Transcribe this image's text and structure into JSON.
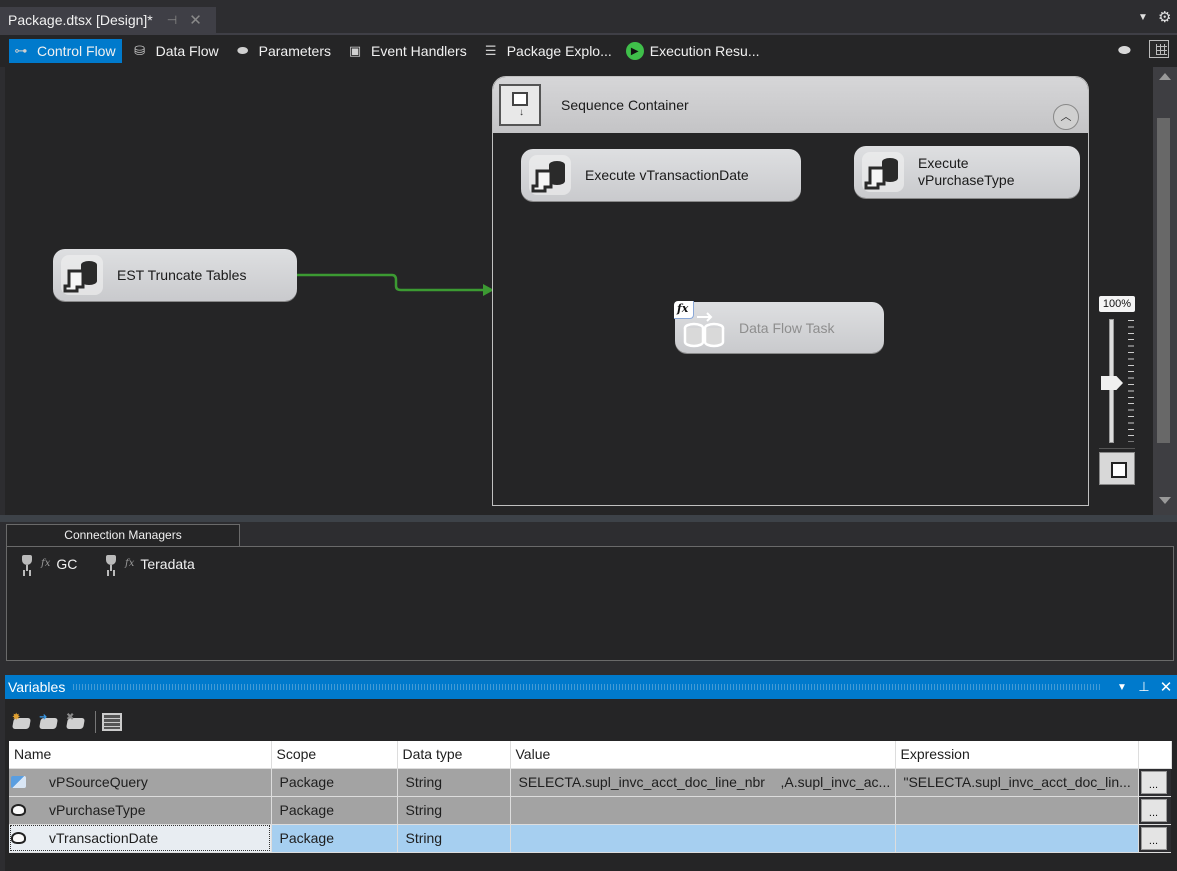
{
  "document_tab": {
    "title": "Package.dtsx [Design]*",
    "pin_icon": "pin-icon",
    "close_icon": "close-icon"
  },
  "designer_tabs": [
    {
      "label": "Control Flow",
      "icon": "control-flow-icon",
      "active": true
    },
    {
      "label": "Data Flow",
      "icon": "data-flow-icon",
      "active": false
    },
    {
      "label": "Parameters",
      "icon": "parameters-icon",
      "active": false
    },
    {
      "label": "Event Handlers",
      "icon": "event-handlers-icon",
      "active": false
    },
    {
      "label": "Package Explo...",
      "icon": "package-explorer-icon",
      "active": false
    },
    {
      "label": "Execution Resu...",
      "icon": "execution-results-icon",
      "active": false
    }
  ],
  "canvas": {
    "tasks": {
      "truncate": {
        "label": "EST Truncate Tables"
      },
      "exec_date": {
        "label": "Execute vTransactionDate"
      },
      "exec_purchase": {
        "label_line1": "Execute",
        "label_line2": "vPurchaseType"
      },
      "data_flow": {
        "label": "Data Flow Task",
        "disabled": true,
        "badge": "fx"
      }
    },
    "container": {
      "label": "Sequence Container"
    },
    "precedence_color": "#3c9a32",
    "zoom": {
      "label": "100%",
      "value_percent": 100
    }
  },
  "connection_managers": {
    "tab_label": "Connection Managers",
    "items": [
      {
        "name": "GC",
        "badge": "fx"
      },
      {
        "name": "Teradata",
        "badge": "fx"
      }
    ]
  },
  "variables": {
    "title": "Variables",
    "columns": [
      "Name",
      "Scope",
      "Data type",
      "Value",
      "Expression"
    ],
    "rows": [
      {
        "icon": "expression-variable-icon",
        "name": "vPSourceQuery",
        "scope": "Package",
        "data_type": "String",
        "value": "SELECTA.supl_invc_acct_doc_line_nbr    ,A.supl_invc_ac...",
        "expression": "\"SELECTA.supl_invc_acct_doc_lin...",
        "button": "..."
      },
      {
        "icon": "variable-icon",
        "name": "vPurchaseType",
        "scope": "Package",
        "data_type": "String",
        "value": "",
        "expression": "",
        "button": "..."
      },
      {
        "icon": "variable-icon",
        "name": "vTransactionDate",
        "scope": "Package",
        "data_type": "String",
        "value": "",
        "expression": "",
        "button": "...",
        "selected": true
      }
    ]
  }
}
